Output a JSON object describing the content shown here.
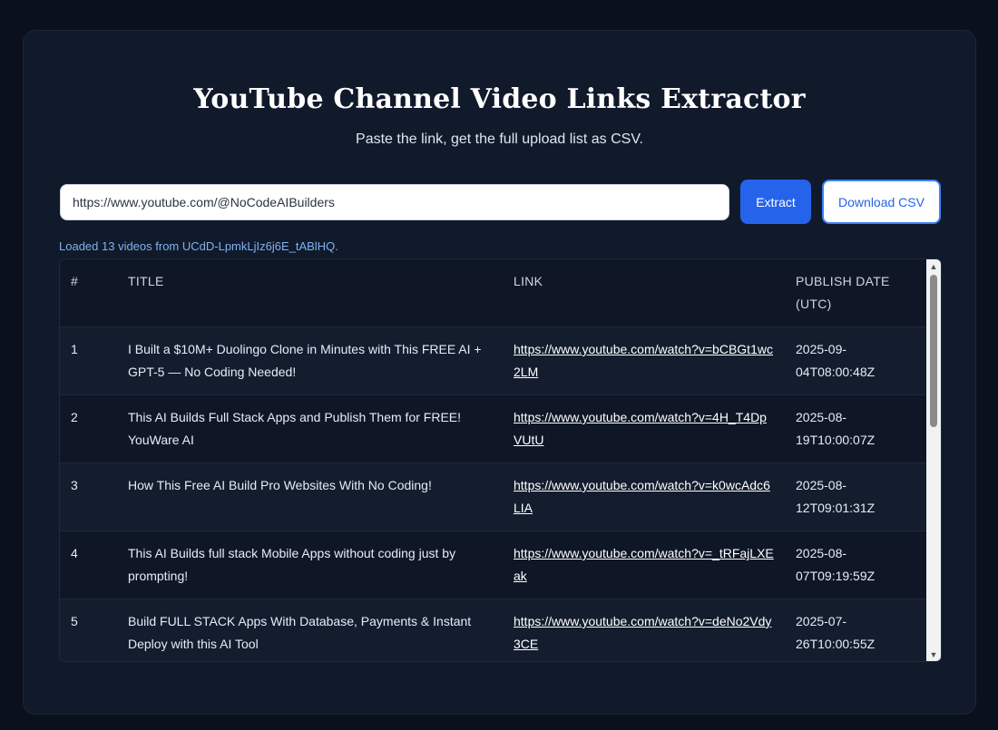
{
  "header": {
    "title": "YouTube Channel Video Links Extractor",
    "subtitle": "Paste the link, get the full upload list as CSV."
  },
  "form": {
    "url_value": "https://www.youtube.com/@NoCodeAIBuilders",
    "extract_label": "Extract",
    "download_label": "Download CSV"
  },
  "status": {
    "text": "Loaded 13 videos from UCdD-LpmkLjIz6j6E_tABlHQ."
  },
  "table": {
    "columns": {
      "num": "#",
      "title": "TITLE",
      "link": "LINK",
      "date": "PUBLISH DATE (UTC)"
    },
    "rows": [
      {
        "num": "1",
        "title": "I Built a $10M+ Duolingo Clone in Minutes with This FREE AI + GPT-5 — No Coding Needed!",
        "link": "https://www.youtube.com/watch?v=bCBGt1wc2LM",
        "date": "2025-09-04T08:00:48Z"
      },
      {
        "num": "2",
        "title": "This AI Builds Full Stack Apps and Publish Them for FREE! YouWare AI",
        "link": "https://www.youtube.com/watch?v=4H_T4DpVUtU",
        "date": "2025-08-19T10:00:07Z"
      },
      {
        "num": "3",
        "title": "How This Free AI Build Pro Websites With No Coding!",
        "link": "https://www.youtube.com/watch?v=k0wcAdc6LIA",
        "date": "2025-08-12T09:01:31Z"
      },
      {
        "num": "4",
        "title": "This AI Builds full stack Mobile Apps without coding just by prompting!",
        "link": "https://www.youtube.com/watch?v=_tRFajLXEak",
        "date": "2025-08-07T09:19:59Z"
      },
      {
        "num": "5",
        "title": "Build FULL STACK Apps With Database, Payments & Instant Deploy with this AI Tool",
        "link": "https://www.youtube.com/watch?v=deNo2Vdy3CE",
        "date": "2025-07-26T10:00:55Z"
      }
    ]
  },
  "icons": {
    "scroll_up": "triangle-up-icon",
    "scroll_down": "triangle-down-icon"
  },
  "colors": {
    "accent": "#2563eb",
    "status_text": "#7fb2f0",
    "background": "#0b111c",
    "card": "#111a2b"
  }
}
